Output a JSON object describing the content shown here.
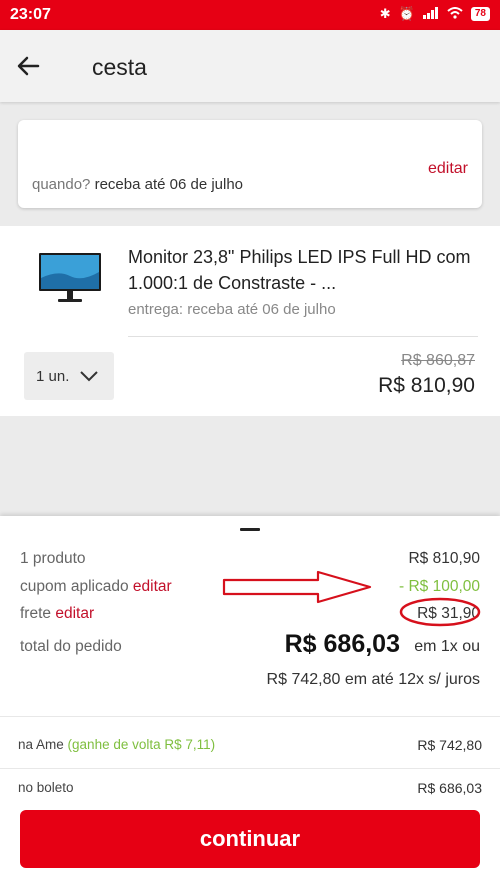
{
  "status": {
    "time": "23:07",
    "battery": "78"
  },
  "header": {
    "title": "cesta"
  },
  "delivery": {
    "edit": "editar",
    "label": "quando?",
    "value": "receba até 06 de julho"
  },
  "item": {
    "title": "Monitor 23,8\" Philips LED IPS Full HD com 1.000:1 de Constraste - ...",
    "delivery": "entrega: receba até 06 de julho",
    "qty": "1 un.",
    "price_old": "R$ 860,87",
    "price_new": "R$ 810,90"
  },
  "summary": {
    "products_label": "1 produto",
    "products_value": "R$ 810,90",
    "coupon_label": "cupom aplicado",
    "coupon_edit": "editar",
    "coupon_value": "- R$ 100,00",
    "shipping_label": "frete",
    "shipping_edit": "editar",
    "shipping_value": "R$ 31,90",
    "total_label": "total do pedido",
    "total_value": "R$ 686,03",
    "total_suffix": "em 1x ou",
    "installments": "R$ 742,80 em até 12x s/ juros",
    "ame_label": "na Ame",
    "ame_cashback": "(ganhe de volta R$ 7,11)",
    "ame_value": "R$ 742,80",
    "boleto_label": "no boleto",
    "boleto_value": "R$ 686,03",
    "continue": "continuar"
  },
  "colors": {
    "brand": "#e60014",
    "link": "#c2102a",
    "discount": "#7fbf3f"
  }
}
